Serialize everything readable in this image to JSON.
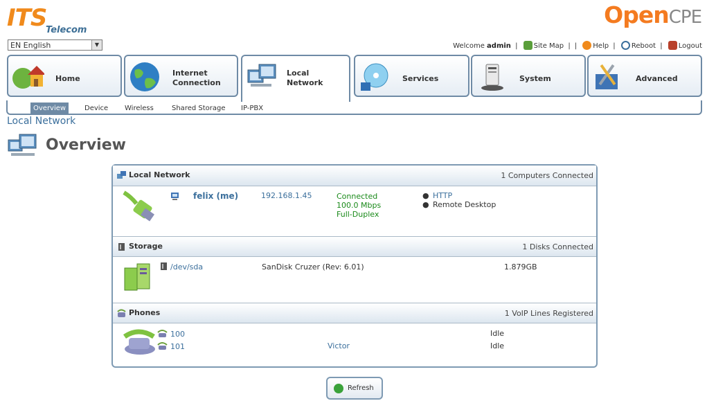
{
  "header": {
    "brand_left_main": "ITS",
    "brand_left_sub": "Telecom",
    "brand_right_a": "Open",
    "brand_right_b": "CPE",
    "language": "EN English"
  },
  "toplinks": {
    "welcome": "Welcome",
    "user": "admin",
    "site_map": "Site Map",
    "help": "Help",
    "reboot": "Reboot",
    "logout": "Logout"
  },
  "tabs": [
    {
      "label_1": "Home",
      "label_2": "",
      "icon": "home-icon"
    },
    {
      "label_1": "Internet",
      "label_2": "Connection",
      "icon": "globe-icon"
    },
    {
      "label_1": "Local",
      "label_2": "Network",
      "icon": "computers-icon"
    },
    {
      "label_1": "Services",
      "label_2": "",
      "icon": "disc-icon"
    },
    {
      "label_1": "System",
      "label_2": "",
      "icon": "device-icon"
    },
    {
      "label_1": "Advanced",
      "label_2": "",
      "icon": "tools-icon"
    }
  ],
  "subnav": [
    "Overview",
    "Device",
    "Wireless",
    "Shared Storage",
    "IP-PBX"
  ],
  "breadcrumb": "Local Network",
  "page_title": "Overview",
  "sections": {
    "local_network": {
      "title": "Local Network",
      "summary": "1 Computers Connected",
      "host": "felix (me)",
      "ip": "192.168.1.45",
      "status": [
        "Connected",
        "100.0 Mbps",
        "Full-Duplex"
      ],
      "services": [
        "HTTP",
        "Remote Desktop"
      ]
    },
    "storage": {
      "title": "Storage",
      "summary": "1 Disks Connected",
      "device": "/dev/sda",
      "model": "SanDisk Cruzer (Rev: 6.01)",
      "size": "1.879GB"
    },
    "phones": {
      "title": "Phones",
      "summary": "1 VoIP Lines Registered",
      "lines": [
        {
          "number": "100",
          "name": "",
          "status": "Idle"
        },
        {
          "number": "101",
          "name": "Victor",
          "status": "Idle"
        }
      ]
    }
  },
  "refresh_label": "Refresh",
  "colors": {
    "accent": "#6e8aa5",
    "link": "#3b6f9c",
    "brand_orange": "#f47b20",
    "status_green": "#1a8a1a"
  }
}
